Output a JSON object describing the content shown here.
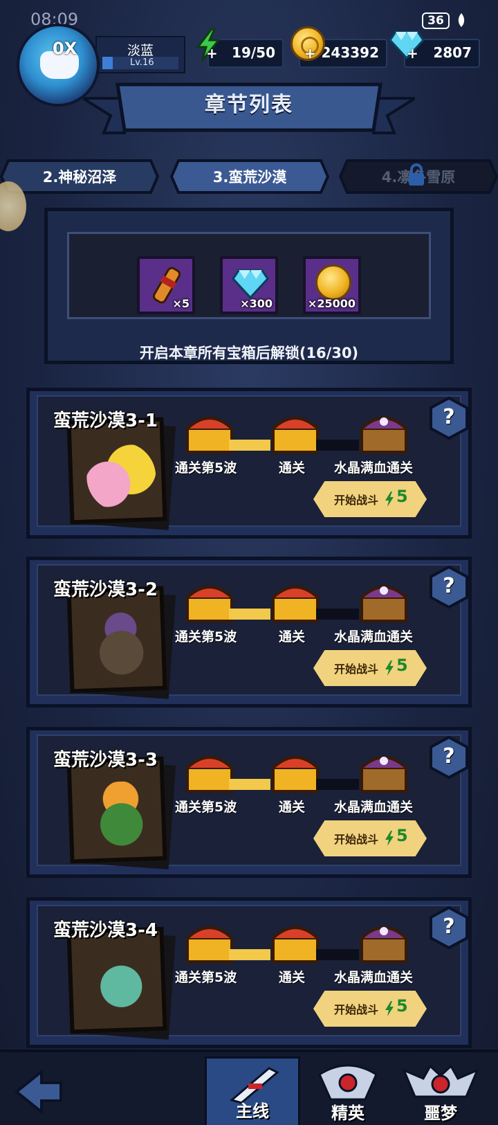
{
  "status": {
    "time": "08:09",
    "battery": "36"
  },
  "player": {
    "name": "淡蓝",
    "level": "Lv.16",
    "speed_badge": "0X"
  },
  "resources": {
    "energy": "19/50",
    "gold": "243392",
    "gems": "2807"
  },
  "banner": {
    "title": "章节列表"
  },
  "chapter_tabs": [
    {
      "label": "2.神秘沼泽",
      "state": "available"
    },
    {
      "label": "3.蛮荒沙漠",
      "state": "selected"
    },
    {
      "label": "4.凛冬雪原",
      "state": "locked"
    }
  ],
  "chapter_rewards": {
    "items": [
      {
        "icon": "scroll-icon",
        "qty": "×5"
      },
      {
        "icon": "diamond-icon",
        "qty": "×300"
      },
      {
        "icon": "gold-coin-icon",
        "qty": "×25000"
      }
    ],
    "unlock_text": "开启本章所有宝箱后解锁(16/30)"
  },
  "levels": [
    {
      "title": "蛮荒沙漠3-1",
      "monster": "pink-slug-monster",
      "conditions": [
        "通关第5波",
        "通关",
        "水晶满血通关"
      ],
      "start_label": "开始战斗",
      "cost": "5"
    },
    {
      "title": "蛮荒沙漠3-2",
      "monster": "haunted-tree-monster",
      "conditions": [
        "通关第5波",
        "通关",
        "水晶满血通关"
      ],
      "start_label": "开始战斗",
      "cost": "5"
    },
    {
      "title": "蛮荒沙漠3-3",
      "monster": "cactus-eye-monster",
      "conditions": [
        "通关第5波",
        "通关",
        "水晶满血通关"
      ],
      "start_label": "开始战斗",
      "cost": "5"
    },
    {
      "title": "蛮荒沙漠3-4",
      "monster": "sandworm-monster",
      "conditions": [
        "通关第5波",
        "通关",
        "水晶满血通关"
      ],
      "start_label": "开始战斗",
      "cost": "5"
    }
  ],
  "help_label": "?",
  "bottom_nav": {
    "main": "主线",
    "elite": "精英",
    "nightmare": "噩梦"
  },
  "colors": {
    "accent_gold": "#f1d27f",
    "energy_green": "#3ec94a",
    "panel": "#21305a"
  }
}
